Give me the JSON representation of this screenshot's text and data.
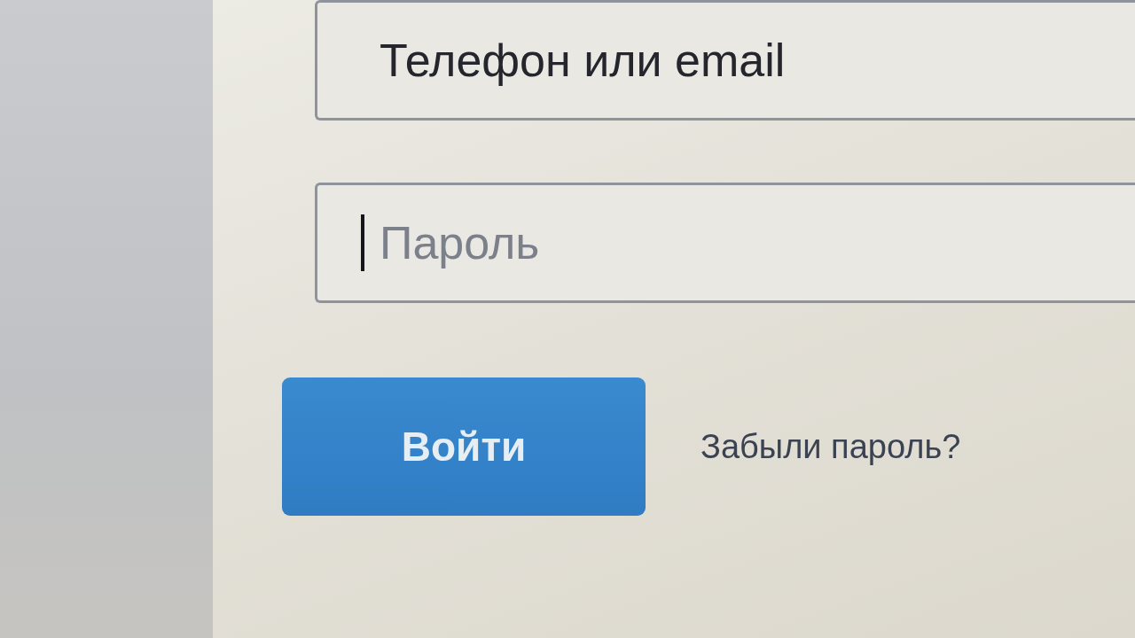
{
  "login_form": {
    "fields": [
      {
        "value": "Телефон или email",
        "focused": false
      },
      {
        "placeholder": "Пароль",
        "focused": true
      }
    ],
    "submit_button": {
      "label": "Войти"
    },
    "forgot_link": {
      "label": "Забыли пароль?"
    }
  }
}
